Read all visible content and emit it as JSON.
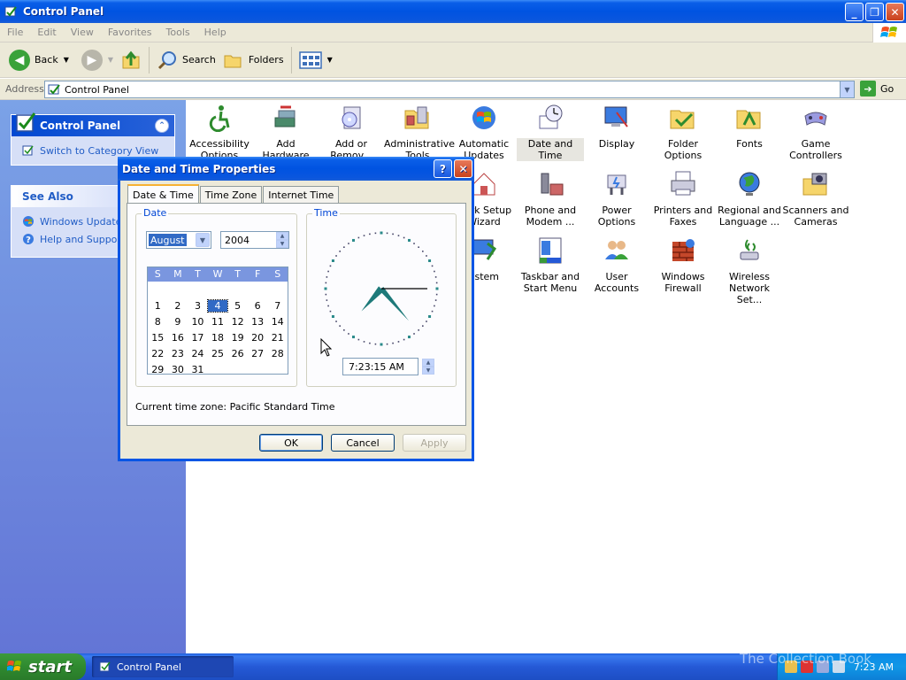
{
  "window": {
    "title": "Control Panel"
  },
  "menu": [
    "File",
    "Edit",
    "View",
    "Favorites",
    "Tools",
    "Help"
  ],
  "toolbar": {
    "back": "Back",
    "search": "Search",
    "folders": "Folders"
  },
  "address": {
    "label": "Address",
    "value": "Control Panel",
    "go": "Go"
  },
  "left_pane": {
    "panel_title": "Control Panel",
    "switch_link": "Switch to Category View",
    "see_also_title": "See Also",
    "see_also": [
      "Windows Update",
      "Help and Support"
    ]
  },
  "icons": [
    {
      "label": "Accessibility Options"
    },
    {
      "label": "Add Hardware"
    },
    {
      "label": "Add or Remov..."
    },
    {
      "label": "Administrative Tools"
    },
    {
      "label": "Automatic Updates"
    },
    {
      "label": "Date and Time"
    },
    {
      "label": "Display"
    },
    {
      "label": "Folder Options"
    },
    {
      "label": "Fonts"
    },
    {
      "label": "Game Controllers"
    },
    {
      "label": "work Setup Wizard"
    },
    {
      "label": "Phone and Modem ..."
    },
    {
      "label": "Power Options"
    },
    {
      "label": "Printers and Faxes"
    },
    {
      "label": "Regional and Language ..."
    },
    {
      "label": "Scanners and Cameras"
    },
    {
      "label": "ystem"
    },
    {
      "label": "Taskbar and Start Menu"
    },
    {
      "label": "User Accounts"
    },
    {
      "label": "Windows Firewall"
    },
    {
      "label": "Wireless Network Set..."
    }
  ],
  "dialog": {
    "title": "Date and Time Properties",
    "tabs": [
      "Date & Time",
      "Time Zone",
      "Internet Time"
    ],
    "date_group": "Date",
    "time_group": "Time",
    "month": "August",
    "year": "2004",
    "weekdays": [
      "S",
      "M",
      "T",
      "W",
      "T",
      "F",
      "S"
    ],
    "weeks": [
      [
        "",
        "",
        "",
        "",
        "",
        "",
        ""
      ],
      [
        "1",
        "2",
        "3",
        "4",
        "5",
        "6",
        "7"
      ],
      [
        "8",
        "9",
        "10",
        "11",
        "12",
        "13",
        "14"
      ],
      [
        "15",
        "16",
        "17",
        "18",
        "19",
        "20",
        "21"
      ],
      [
        "22",
        "23",
        "24",
        "25",
        "26",
        "27",
        "28"
      ],
      [
        "29",
        "30",
        "31",
        "",
        "",
        "",
        ""
      ]
    ],
    "selected_day": "4",
    "time_value": "7:23:15 AM",
    "clock": {
      "hour": 7,
      "minute": 23,
      "second": 15
    },
    "timezone": "Current time zone:  Pacific Standard Time",
    "ok": "OK",
    "cancel": "Cancel",
    "apply": "Apply"
  },
  "taskbar": {
    "start": "start",
    "task": "Control Panel",
    "clock": "7:23 AM",
    "watermark": "The Collection Book"
  }
}
